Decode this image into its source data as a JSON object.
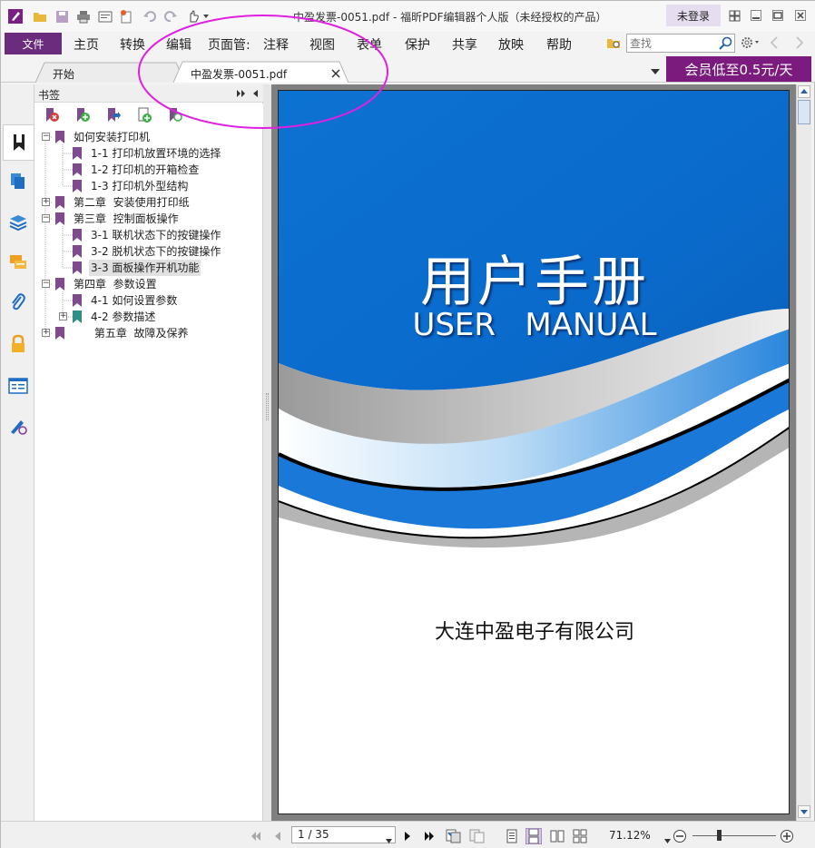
{
  "window": {
    "title": "中盈发票-0051.pdf - 福昕PDF编辑器个人版（未经授权的产品）",
    "login_label": "未登录"
  },
  "menu": {
    "file_label": "文件",
    "items": [
      "主页",
      "转换",
      "编辑",
      "页面管:",
      "注释",
      "视图",
      "表单",
      "保护",
      "共享",
      "放映",
      "帮助"
    ]
  },
  "search": {
    "placeholder": "查找"
  },
  "tabs": [
    {
      "label": "开始"
    },
    {
      "label": "中盈发票-0051.pdf"
    }
  ],
  "promo": {
    "label": "会员低至0.5元/天"
  },
  "bookmarks": {
    "panel_title": "书签",
    "items": [
      {
        "label": "如何安装打印机",
        "level": 0,
        "expander": "−",
        "color": "#7d4b8e"
      },
      {
        "label": "1-1 打印机放置环境的选择",
        "level": 1,
        "expander": "",
        "color": "#7d4b8e"
      },
      {
        "label": "1-2 打印机的开箱检查",
        "level": 1,
        "expander": "",
        "color": "#7d4b8e"
      },
      {
        "label": "1-3 打印机外型结构",
        "level": 1,
        "expander": "",
        "color": "#7d4b8e"
      },
      {
        "label": "第二章  安装使用打印纸",
        "level": 0,
        "expander": "+",
        "color": "#7d4b8e"
      },
      {
        "label": "第三章  控制面板操作",
        "level": 0,
        "expander": "−",
        "color": "#7d4b8e"
      },
      {
        "label": "3-1 联机状态下的按键操作",
        "level": 1,
        "expander": "",
        "color": "#7d4b8e"
      },
      {
        "label": "3-2 脱机状态下的按键操作",
        "level": 1,
        "expander": "",
        "color": "#7d4b8e"
      },
      {
        "label": "3-3 面板操作开机功能",
        "level": 1,
        "expander": "",
        "color": "#7d4b8e",
        "selected": true
      },
      {
        "label": "第四章  参数设置",
        "level": 0,
        "expander": "−",
        "color": "#7d4b8e"
      },
      {
        "label": "4-1 如何设置参数",
        "level": 1,
        "expander": "",
        "color": "#7d4b8e"
      },
      {
        "label": "4-2 参数描述",
        "level": 1,
        "expander": "+",
        "color": "#2f8f86"
      },
      {
        "label": "      第五章  故障及保养",
        "level": 0,
        "expander": "+",
        "color": "#7d4b8e"
      }
    ]
  },
  "document": {
    "heading_cn": "用户手册",
    "heading_en": "USER   MANUAL",
    "company": "大连中盈电子有限公司"
  },
  "statusbar": {
    "page_value": "1 / 35",
    "zoom": "71.12%"
  },
  "colors": {
    "accent": "#6b2c7d",
    "promo": "#7a1b7d",
    "cover_blue": "#0a6fd0",
    "annotation_circle": "#e020e0"
  }
}
